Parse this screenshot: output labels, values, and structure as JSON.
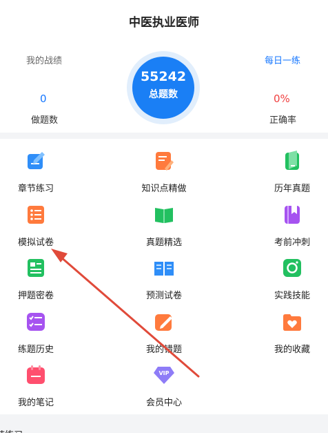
{
  "status": {
    "icons_text": "▾ ◂ ▮"
  },
  "header": {
    "title": "中医执业医师"
  },
  "stats": {
    "my_record_label": "我的战绩",
    "daily_link": "每日一练",
    "done_count": "0",
    "done_label": "做题数",
    "total_count": "55242",
    "total_label": "总题数",
    "accuracy": "0%",
    "accuracy_label": "正确率"
  },
  "grid": [
    {
      "label": "章节练习",
      "icon": "chapter-practice-icon",
      "color": "#2f8ef8"
    },
    {
      "label": "知识点精做",
      "icon": "knowledge-point-icon",
      "color": "#ff7a3d"
    },
    {
      "label": "历年真题",
      "icon": "past-exams-icon",
      "color": "#22c060"
    },
    {
      "label": "模拟试卷",
      "icon": "mock-exam-icon",
      "color": "#ff7a3d"
    },
    {
      "label": "真题精选",
      "icon": "book-open-icon",
      "color": "#22c060"
    },
    {
      "label": "考前冲刺",
      "icon": "bookmark-book-icon",
      "color": "#a653f0"
    },
    {
      "label": "押题密卷",
      "icon": "secret-paper-icon",
      "color": "#22c060"
    },
    {
      "label": "预测试卷",
      "icon": "open-book-icon",
      "color": "#2f8ef8"
    },
    {
      "label": "实践技能",
      "icon": "camera-icon",
      "color": "#22c060"
    },
    {
      "label": "练题历史",
      "icon": "history-list-icon",
      "color": "#a653f0"
    },
    {
      "label": "我的错题",
      "icon": "pencil-edit-icon",
      "color": "#ff7a3d"
    },
    {
      "label": "我的收藏",
      "icon": "heart-folder-icon",
      "color": "#ff7a3d"
    },
    {
      "label": "我的笔记",
      "icon": "notebook-icon",
      "color": "#ff4f6e"
    },
    {
      "label": "会员中心",
      "icon": "vip-diamond-icon",
      "color": "#8e7cf7",
      "badge": "VIP"
    }
  ],
  "bottom_section": {
    "title_partial": "节练习"
  },
  "annotation": {
    "arrow_color": "#e04a3a"
  }
}
